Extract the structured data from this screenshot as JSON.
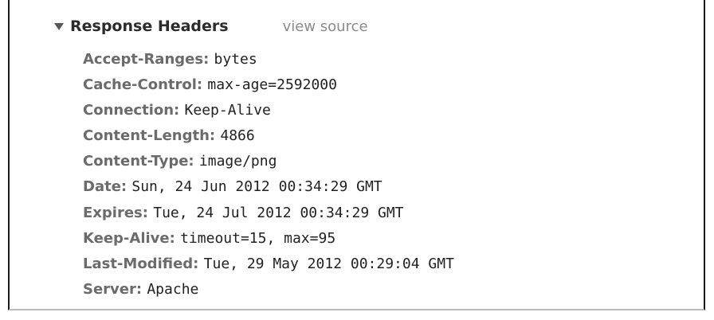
{
  "section": {
    "title": "Response Headers",
    "view_source_label": "view source"
  },
  "headers": [
    {
      "name": "Accept-Ranges:",
      "value": "bytes"
    },
    {
      "name": "Cache-Control:",
      "value": "max-age=2592000"
    },
    {
      "name": "Connection:",
      "value": "Keep-Alive"
    },
    {
      "name": "Content-Length:",
      "value": "4866"
    },
    {
      "name": "Content-Type:",
      "value": "image/png"
    },
    {
      "name": "Date:",
      "value": "Sun, 24 Jun 2012 00:34:29 GMT"
    },
    {
      "name": "Expires:",
      "value": "Tue, 24 Jul 2012 00:34:29 GMT"
    },
    {
      "name": "Keep-Alive:",
      "value": "timeout=15, max=95"
    },
    {
      "name": "Last-Modified:",
      "value": "Tue, 29 May 2012 00:29:04 GMT"
    },
    {
      "name": "Server:",
      "value": "Apache"
    }
  ]
}
